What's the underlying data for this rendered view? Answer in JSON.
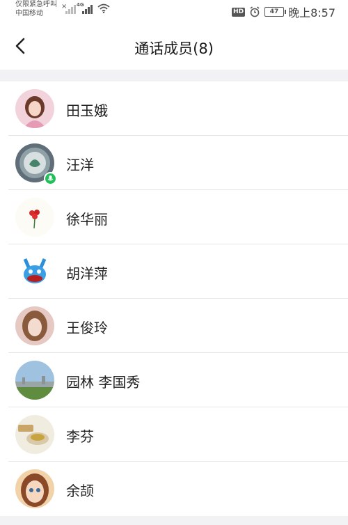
{
  "status_bar": {
    "carrier_line1": "仅限紧急呼叫",
    "carrier_line2": "中国移动",
    "sim_x": "×",
    "network": "4G",
    "hd": "HD",
    "battery": "47",
    "time": "晚上8:57",
    "icons": [
      "signal-icon",
      "wifi-icon",
      "alarm-icon",
      "battery-icon"
    ]
  },
  "header": {
    "title": "通话成员(8)",
    "back_icon": "chevron-left-icon"
  },
  "members": [
    {
      "name": "田玉娥",
      "avatar_color": "#e8b8c8",
      "speaking": false
    },
    {
      "name": "汪洋",
      "avatar_color": "#6f7f8a",
      "speaking": true
    },
    {
      "name": "徐华丽",
      "avatar_color": "#fdfbf5",
      "speaking": false
    },
    {
      "name": "胡洋萍",
      "avatar_color": "#3aa0e6",
      "speaking": false
    },
    {
      "name": "王俊玲",
      "avatar_color": "#c9a48c",
      "speaking": false
    },
    {
      "name": "园林 李国秀",
      "avatar_color": "#7ea9cf",
      "speaking": false
    },
    {
      "name": "李芬",
      "avatar_color": "#d9c9a8",
      "speaking": false
    },
    {
      "name": "余颉",
      "avatar_color": "#e9b07a",
      "speaking": false
    }
  ],
  "colors": {
    "background": "#ffffff",
    "separator_band": "#f2f2f4",
    "speaking_badge": "#21c05a"
  }
}
